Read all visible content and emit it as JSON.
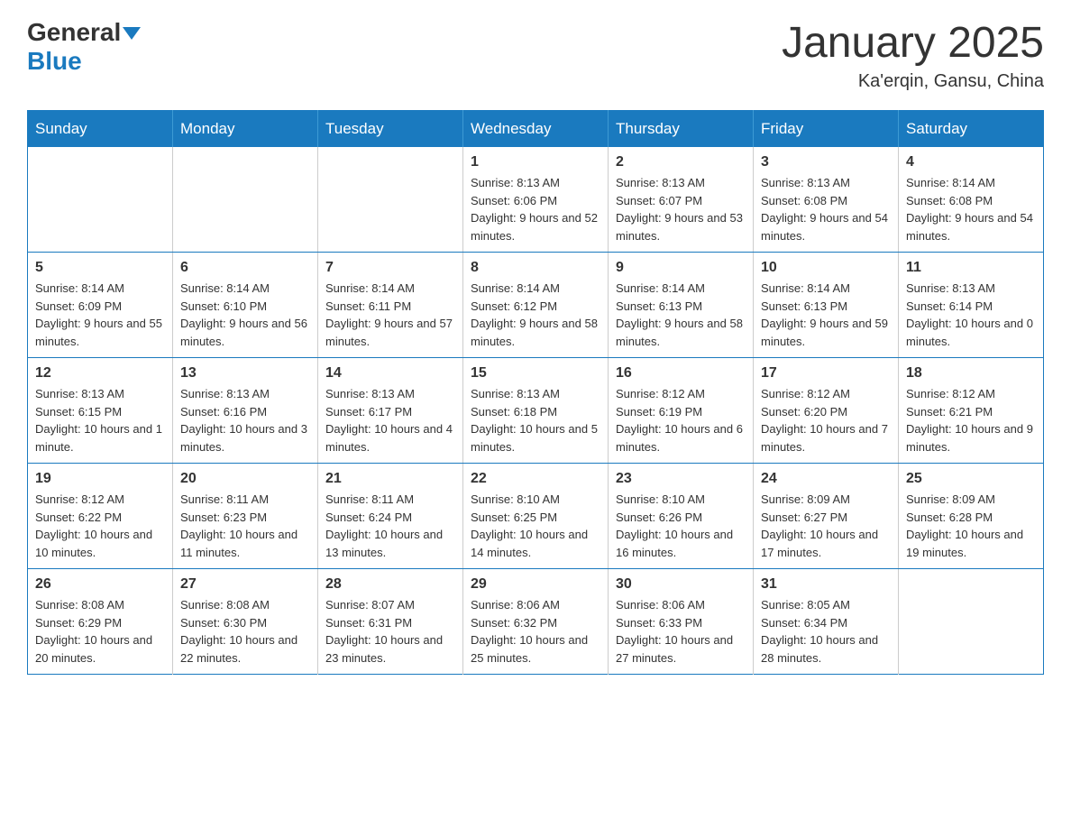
{
  "logo": {
    "general": "General",
    "blue": "Blue"
  },
  "title": "January 2025",
  "location": "Ka'erqin, Gansu, China",
  "days_of_week": [
    "Sunday",
    "Monday",
    "Tuesday",
    "Wednesday",
    "Thursday",
    "Friday",
    "Saturday"
  ],
  "weeks": [
    [
      {
        "day": "",
        "info": ""
      },
      {
        "day": "",
        "info": ""
      },
      {
        "day": "",
        "info": ""
      },
      {
        "day": "1",
        "info": "Sunrise: 8:13 AM\nSunset: 6:06 PM\nDaylight: 9 hours and 52 minutes."
      },
      {
        "day": "2",
        "info": "Sunrise: 8:13 AM\nSunset: 6:07 PM\nDaylight: 9 hours and 53 minutes."
      },
      {
        "day": "3",
        "info": "Sunrise: 8:13 AM\nSunset: 6:08 PM\nDaylight: 9 hours and 54 minutes."
      },
      {
        "day": "4",
        "info": "Sunrise: 8:14 AM\nSunset: 6:08 PM\nDaylight: 9 hours and 54 minutes."
      }
    ],
    [
      {
        "day": "5",
        "info": "Sunrise: 8:14 AM\nSunset: 6:09 PM\nDaylight: 9 hours and 55 minutes."
      },
      {
        "day": "6",
        "info": "Sunrise: 8:14 AM\nSunset: 6:10 PM\nDaylight: 9 hours and 56 minutes."
      },
      {
        "day": "7",
        "info": "Sunrise: 8:14 AM\nSunset: 6:11 PM\nDaylight: 9 hours and 57 minutes."
      },
      {
        "day": "8",
        "info": "Sunrise: 8:14 AM\nSunset: 6:12 PM\nDaylight: 9 hours and 58 minutes."
      },
      {
        "day": "9",
        "info": "Sunrise: 8:14 AM\nSunset: 6:13 PM\nDaylight: 9 hours and 58 minutes."
      },
      {
        "day": "10",
        "info": "Sunrise: 8:14 AM\nSunset: 6:13 PM\nDaylight: 9 hours and 59 minutes."
      },
      {
        "day": "11",
        "info": "Sunrise: 8:13 AM\nSunset: 6:14 PM\nDaylight: 10 hours and 0 minutes."
      }
    ],
    [
      {
        "day": "12",
        "info": "Sunrise: 8:13 AM\nSunset: 6:15 PM\nDaylight: 10 hours and 1 minute."
      },
      {
        "day": "13",
        "info": "Sunrise: 8:13 AM\nSunset: 6:16 PM\nDaylight: 10 hours and 3 minutes."
      },
      {
        "day": "14",
        "info": "Sunrise: 8:13 AM\nSunset: 6:17 PM\nDaylight: 10 hours and 4 minutes."
      },
      {
        "day": "15",
        "info": "Sunrise: 8:13 AM\nSunset: 6:18 PM\nDaylight: 10 hours and 5 minutes."
      },
      {
        "day": "16",
        "info": "Sunrise: 8:12 AM\nSunset: 6:19 PM\nDaylight: 10 hours and 6 minutes."
      },
      {
        "day": "17",
        "info": "Sunrise: 8:12 AM\nSunset: 6:20 PM\nDaylight: 10 hours and 7 minutes."
      },
      {
        "day": "18",
        "info": "Sunrise: 8:12 AM\nSunset: 6:21 PM\nDaylight: 10 hours and 9 minutes."
      }
    ],
    [
      {
        "day": "19",
        "info": "Sunrise: 8:12 AM\nSunset: 6:22 PM\nDaylight: 10 hours and 10 minutes."
      },
      {
        "day": "20",
        "info": "Sunrise: 8:11 AM\nSunset: 6:23 PM\nDaylight: 10 hours and 11 minutes."
      },
      {
        "day": "21",
        "info": "Sunrise: 8:11 AM\nSunset: 6:24 PM\nDaylight: 10 hours and 13 minutes."
      },
      {
        "day": "22",
        "info": "Sunrise: 8:10 AM\nSunset: 6:25 PM\nDaylight: 10 hours and 14 minutes."
      },
      {
        "day": "23",
        "info": "Sunrise: 8:10 AM\nSunset: 6:26 PM\nDaylight: 10 hours and 16 minutes."
      },
      {
        "day": "24",
        "info": "Sunrise: 8:09 AM\nSunset: 6:27 PM\nDaylight: 10 hours and 17 minutes."
      },
      {
        "day": "25",
        "info": "Sunrise: 8:09 AM\nSunset: 6:28 PM\nDaylight: 10 hours and 19 minutes."
      }
    ],
    [
      {
        "day": "26",
        "info": "Sunrise: 8:08 AM\nSunset: 6:29 PM\nDaylight: 10 hours and 20 minutes."
      },
      {
        "day": "27",
        "info": "Sunrise: 8:08 AM\nSunset: 6:30 PM\nDaylight: 10 hours and 22 minutes."
      },
      {
        "day": "28",
        "info": "Sunrise: 8:07 AM\nSunset: 6:31 PM\nDaylight: 10 hours and 23 minutes."
      },
      {
        "day": "29",
        "info": "Sunrise: 8:06 AM\nSunset: 6:32 PM\nDaylight: 10 hours and 25 minutes."
      },
      {
        "day": "30",
        "info": "Sunrise: 8:06 AM\nSunset: 6:33 PM\nDaylight: 10 hours and 27 minutes."
      },
      {
        "day": "31",
        "info": "Sunrise: 8:05 AM\nSunset: 6:34 PM\nDaylight: 10 hours and 28 minutes."
      },
      {
        "day": "",
        "info": ""
      }
    ]
  ]
}
